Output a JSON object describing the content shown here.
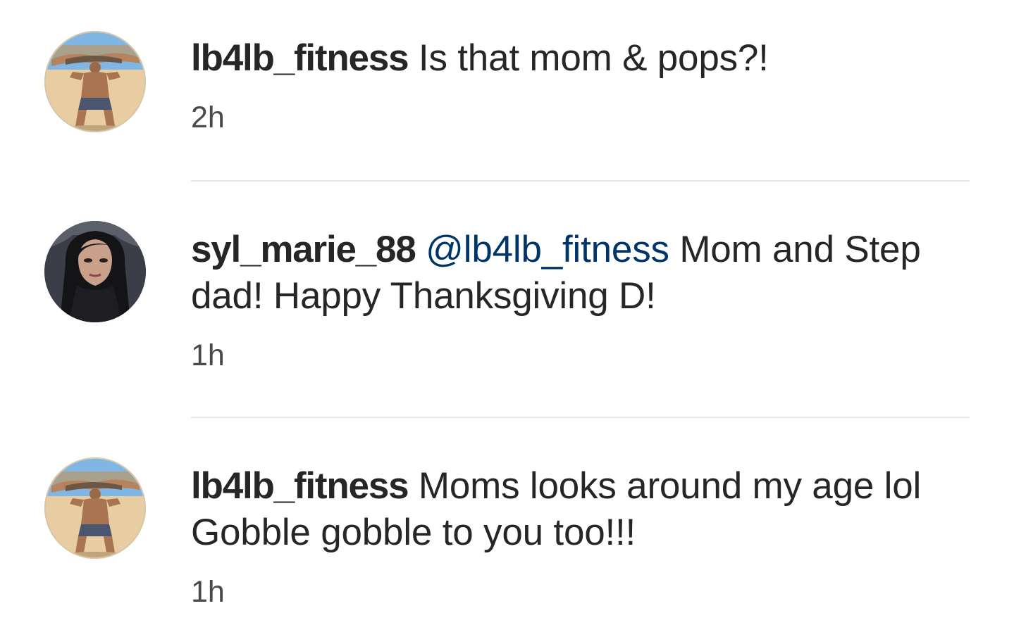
{
  "comments": [
    {
      "username": "lb4lb_fitness",
      "mention": "",
      "text": " Is that mom & pops?!",
      "time": "2h",
      "avatar": "beach-fitness-avatar"
    },
    {
      "username": "syl_marie_88",
      "mention": "@lb4lb_fitness",
      "text": " Mom and Step dad! Happy Thanksgiving D!",
      "time": "1h",
      "avatar": "dark-hair-selfie-avatar"
    },
    {
      "username": "lb4lb_fitness",
      "mention": "",
      "text": " Moms looks around my age lol Gobble gobble to you too!!!",
      "time": "1h",
      "avatar": "beach-fitness-avatar"
    }
  ],
  "colors": {
    "username": "#262626",
    "mention": "#003569",
    "timestamp": "#4a4a4a",
    "divider": "#e6e6e6"
  }
}
